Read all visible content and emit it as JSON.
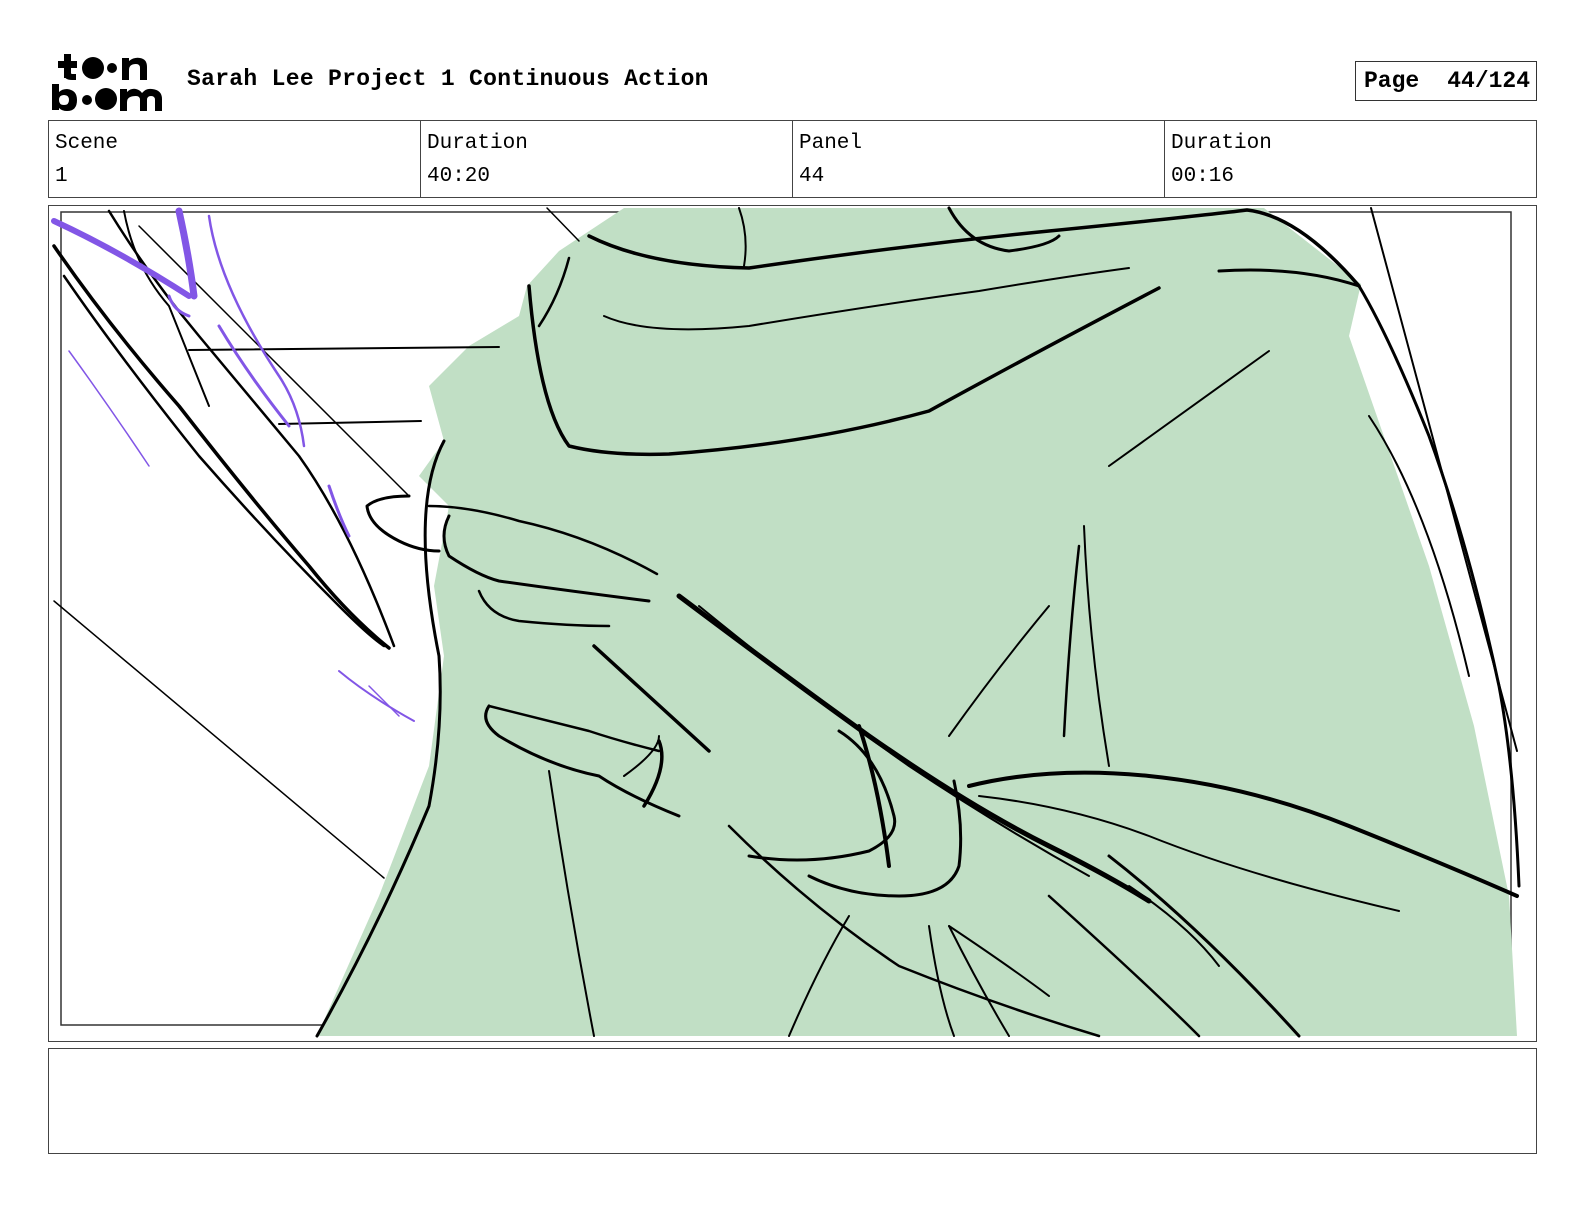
{
  "header": {
    "logo_text": "toon boom",
    "title": "Sarah Lee Project 1 Continuous Action",
    "page_label": "Page",
    "page_value": "44/124"
  },
  "info": {
    "scene_label": "Scene",
    "scene_value": "1",
    "duration_label": "Duration",
    "duration_value": "40:20",
    "panel_label": "Panel",
    "panel_value": "44",
    "panel_duration_label": "Duration",
    "panel_duration_value": "00:16"
  },
  "notes": {
    "text": ""
  },
  "colors": {
    "fill_green": "#c1dfc5",
    "line": "#000000",
    "accent_purple": "#8256e6"
  }
}
